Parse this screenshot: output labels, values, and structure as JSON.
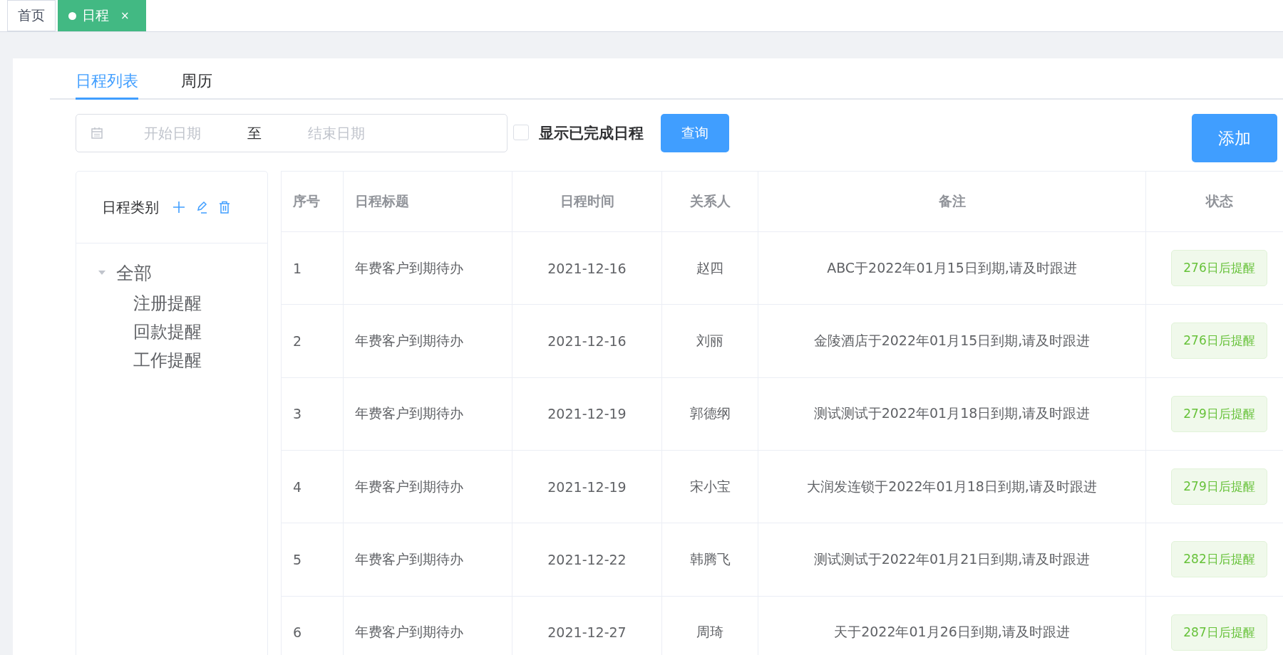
{
  "page_tabs": [
    {
      "label": "首页",
      "selected": false
    },
    {
      "label": "日程",
      "selected": true,
      "close": "×"
    }
  ],
  "view_tabs": [
    {
      "label": "日程列表",
      "selected": true
    },
    {
      "label": "周历",
      "selected": false
    }
  ],
  "filter": {
    "start_placeholder": "开始日期",
    "separator": "至",
    "end_placeholder": "结束日期",
    "show_completed": {
      "label": "显示已完成日程",
      "checked": false
    },
    "query_button": "查询"
  },
  "add_button": "添加",
  "category_panel": {
    "title": "日程类别",
    "tree": [
      {
        "label": "全部",
        "expanded": true,
        "children": [
          {
            "label": "注册提醒"
          },
          {
            "label": "回款提醒"
          },
          {
            "label": "工作提醒"
          }
        ]
      }
    ]
  },
  "table": {
    "columns": [
      "序号",
      "日程标题",
      "日程时间",
      "关系人",
      "备注",
      "状态"
    ],
    "rows": [
      {
        "no": "1",
        "title": "年费客户到期待办",
        "date": "2021-12-16",
        "contact": "赵四",
        "note": "ABC于2022年01月15日到期,请及时跟进",
        "status": "276日后提醒"
      },
      {
        "no": "2",
        "title": "年费客户到期待办",
        "date": "2021-12-16",
        "contact": "刘丽",
        "note": "金陵酒店于2022年01月15日到期,请及时跟进",
        "status": "276日后提醒"
      },
      {
        "no": "3",
        "title": "年费客户到期待办",
        "date": "2021-12-19",
        "contact": "郭德纲",
        "note": "测试测试于2022年01月18日到期,请及时跟进",
        "status": "279日后提醒"
      },
      {
        "no": "4",
        "title": "年费客户到期待办",
        "date": "2021-12-19",
        "contact": "宋小宝",
        "note": "大润发连锁于2022年01月18日到期,请及时跟进",
        "status": "279日后提醒"
      },
      {
        "no": "5",
        "title": "年费客户到期待办",
        "date": "2021-12-22",
        "contact": "韩腾飞",
        "note": "测试测试于2022年01月21日到期,请及时跟进",
        "status": "282日后提醒"
      },
      {
        "no": "6",
        "title": "年费客户到期待办",
        "date": "2021-12-27",
        "contact": "周琦",
        "note": "天于2022年01月26日到期,请及时跟进",
        "status": "287日后提醒"
      }
    ]
  }
}
